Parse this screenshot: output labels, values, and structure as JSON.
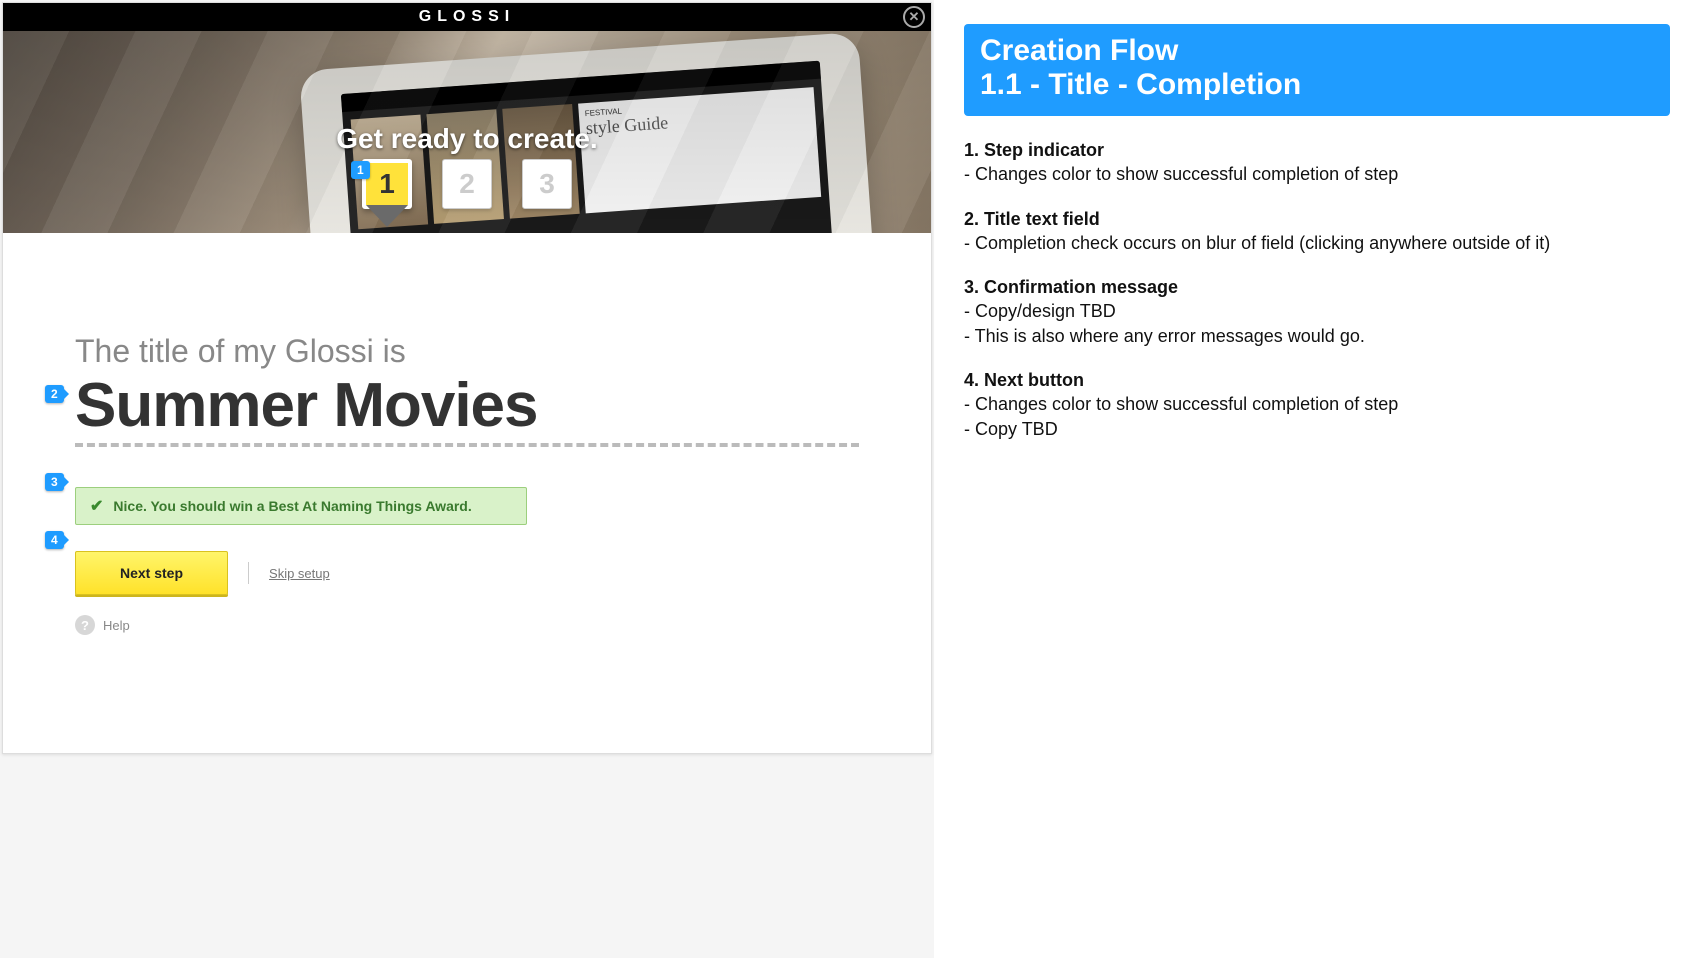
{
  "brand": "GLOSSI",
  "hero_title": "Get ready to create.",
  "steps": [
    "1",
    "2",
    "3"
  ],
  "active_step_index": 0,
  "annotations": {
    "a1": "1",
    "a2": "2",
    "a3": "3",
    "a4": "4"
  },
  "prompt": "The title of my Glossi is",
  "title_value": "Summer Movies",
  "confirmation": "Nice. You should win a Best At Naming Things Award.",
  "next_button": "Next step",
  "skip_link": "Skip setup",
  "help": "Help",
  "spec": {
    "header_line1": "Creation Flow",
    "header_line2": "1.1 - Title - Completion",
    "items": [
      {
        "title": "1. Step indicator",
        "bullets": [
          "- Changes color to show successful completion of step"
        ]
      },
      {
        "title": "2. Title text field",
        "bullets": [
          "- Completion check occurs on blur of field (clicking anywhere outside of it)"
        ]
      },
      {
        "title": "3. Confirmation message",
        "bullets": [
          "- Copy/design TBD",
          "- This is also where any error messages would go."
        ]
      },
      {
        "title": "4. Next button",
        "bullets": [
          "- Changes color to show successful completion of step",
          "- Copy TBD"
        ]
      }
    ]
  }
}
